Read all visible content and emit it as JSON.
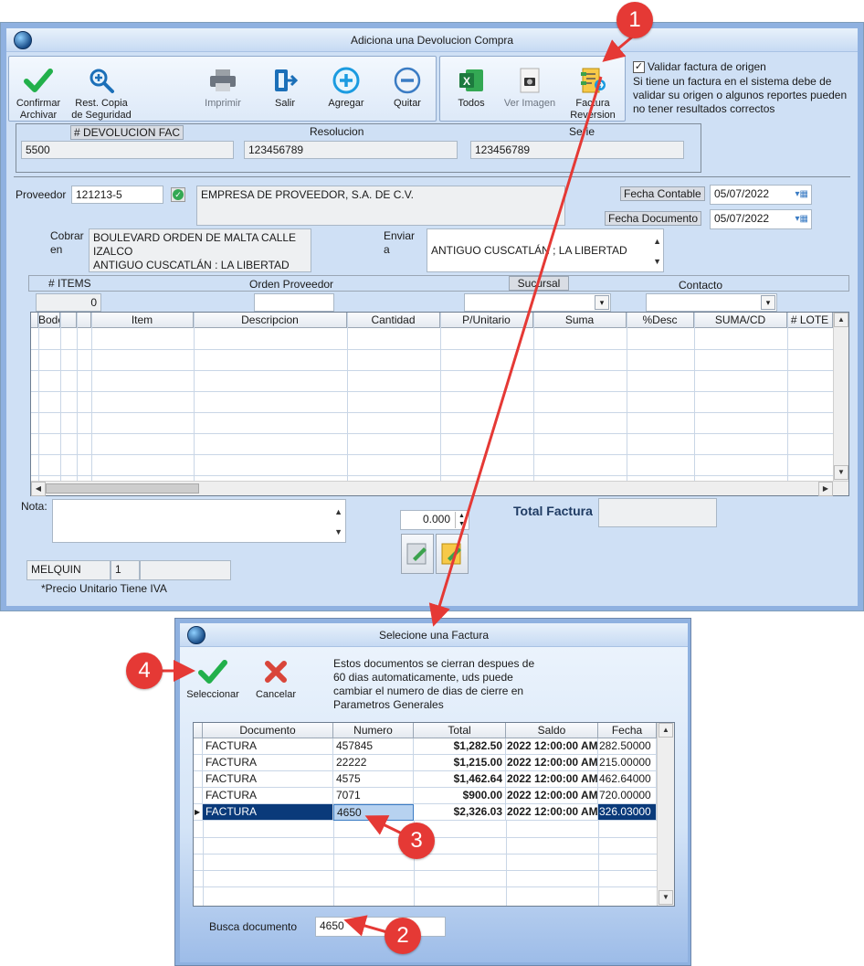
{
  "main_window": {
    "title": "Adiciona una Devolucion Compra",
    "toolbar": {
      "confirm_label": "Confirmar\nArchivar",
      "restore_label": "Rest. Copia\nde Seguridad",
      "print_label": "Imprimir",
      "exit_label": "Salir",
      "add_label": "Agregar",
      "remove_label": "Quitar",
      "all_label": "Todos",
      "view_image_label": "Ver Imagen",
      "invoice_reversal_label": "Factura\nReversion"
    },
    "validate_checkbox": {
      "label": "Validar factura de origen",
      "checked": true
    },
    "validate_note": "Si tiene un factura en el sistema debe de validar su origen o algunos reportes pueden no tener resultados correctos",
    "doc_fields": {
      "devolucion_label": "# DEVOLUCION FAC",
      "devolucion_value": "5500",
      "resolucion_label": "Resolucion",
      "resolucion_value": "123456789",
      "serie_label": "Serie",
      "serie_value": "123456789"
    },
    "proveedor": {
      "label": "Proveedor",
      "code": "121213-5",
      "name": "EMPRESA DE PROVEEDOR, S.A. DE C.V."
    },
    "fecha_contable": {
      "label": "Fecha Contable",
      "value": "05/07/2022"
    },
    "fecha_documento": {
      "label": "Fecha Documento",
      "value": "05/07/2022"
    },
    "cobrar": {
      "label": "Cobrar\nen",
      "value": "BOULEVARD ORDEN DE MALTA CALLE IZALCO\nANTIGUO CUSCATLÁN : LA LIBERTAD"
    },
    "enviar": {
      "label": "Enviar\na",
      "value": "ANTIGUO CUSCATLÁN ; LA LIBERTAD"
    },
    "items_bar": {
      "items_label": "# ITEMS",
      "items_value": "0",
      "orden_label": "Orden Proveedor",
      "sucursal_label": "Sucursal",
      "contacto_label": "Contacto"
    },
    "lines_grid": {
      "columns": [
        "Bodega",
        "Item",
        "Descripcion",
        "Cantidad",
        "P/Unitario",
        "Suma",
        "%Desc",
        "SUMA/CD",
        "# LOTE"
      ]
    },
    "nota_label": "Nota:",
    "amount_value": "0.000",
    "total_factura_label": "Total Factura",
    "user": {
      "name": "MELQUIN",
      "number": "1"
    },
    "iva_note": "*Precio Unitario Tiene IVA"
  },
  "dialog": {
    "title": "Selecione una Factura",
    "select_label": "Seleccionar",
    "cancel_label": "Cancelar",
    "note": "Estos documentos se cierran despues de 60 dias automaticamente, uds puede cambiar el numero de dias de cierre en Parametros Generales",
    "columns": [
      "Documento",
      "Numero",
      "Total",
      "Saldo",
      "Fecha"
    ],
    "rows": [
      {
        "documento": "FACTURA",
        "numero": "457845",
        "total": "$1,282.50",
        "saldo": "2022 12:00:00 AM",
        "fecha": "282.50000"
      },
      {
        "documento": "FACTURA",
        "numero": "22222",
        "total": "$1,215.00",
        "saldo": "2022 12:00:00 AM",
        "fecha": "215.00000"
      },
      {
        "documento": "FACTURA",
        "numero": "4575",
        "total": "$1,462.64",
        "saldo": "2022 12:00:00 AM",
        "fecha": "462.64000"
      },
      {
        "documento": "FACTURA",
        "numero": "7071",
        "total": "$900.00",
        "saldo": "2022 12:00:00 AM",
        "fecha": "720.00000"
      },
      {
        "documento": "FACTURA",
        "numero": "4650",
        "total": "$2,326.03",
        "saldo": "2022 12:00:00 AM",
        "fecha": "326.03000"
      }
    ],
    "selected_row_index": 4,
    "search_label": "Busca documento",
    "search_value": "4650"
  },
  "callouts": [
    "1",
    "2",
    "3",
    "4"
  ],
  "colors": {
    "callout": "#e53935",
    "selected_row": "#0a3a7a",
    "window_bg": "#cfe0f5"
  }
}
